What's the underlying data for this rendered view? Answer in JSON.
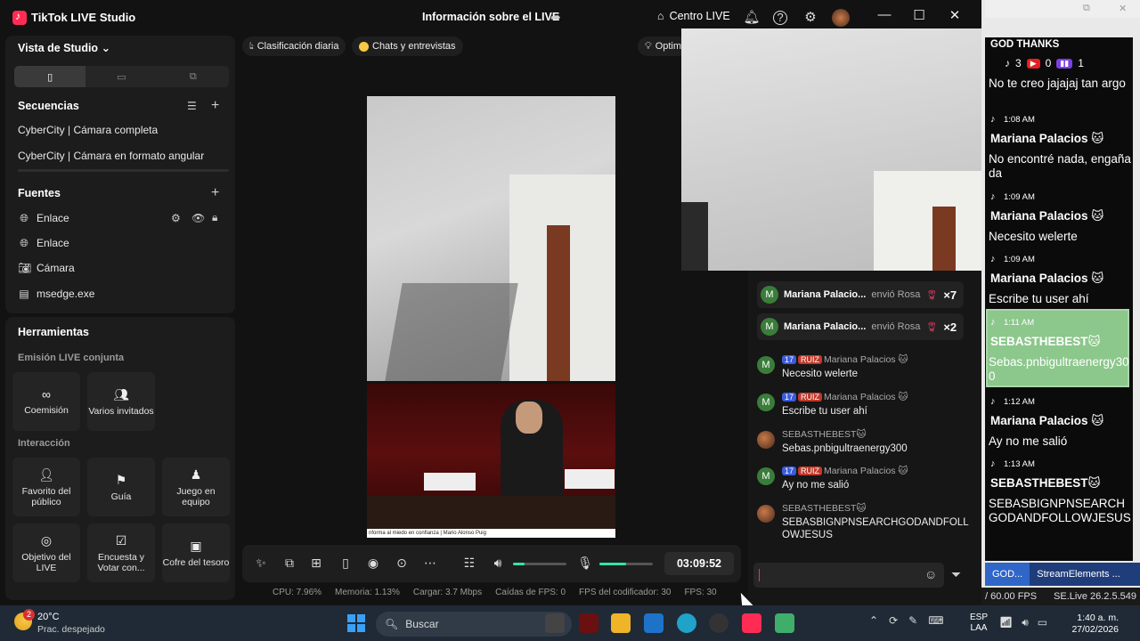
{
  "titlebar": {
    "app_name": "TikTok LIVE Studio",
    "center_title": "Información sobre el LIVE",
    "centro_live": "Centro LIVE"
  },
  "studio_panel": {
    "title": "Vista de Studio",
    "sequences_label": "Secuencias",
    "sequences": [
      "CyberCity | Cámara completa",
      "CyberCity | Cámara en formato angular"
    ],
    "sources_label": "Fuentes",
    "sources": [
      {
        "label": "Enlace",
        "icon": "globe-icon"
      },
      {
        "label": "Enlace",
        "icon": "globe-icon"
      },
      {
        "label": "Cámara",
        "icon": "camera-icon"
      },
      {
        "label": "msedge.exe",
        "icon": "window-icon"
      }
    ]
  },
  "tools_panel": {
    "title": "Herramientas",
    "section_joint": "Emisión LIVE conjunta",
    "coemision": "Coemisión",
    "varios_invitados": "Varios invitados",
    "section_interaction": "Interacción",
    "favorito": "Favorito del público",
    "guia": "Guía",
    "juego": "Juego en equipo",
    "objetivo": "Objetivo del LIVE",
    "encuesta": "Encuesta y Votar con...",
    "cofre": "Cofre del tesoro"
  },
  "chips": {
    "ranking": "Clasificación diaria",
    "chats": "Chats y entrevistas",
    "optim": "Optim"
  },
  "preview": {
    "caption": "nforma al miedo en confianza | Mario Alonso Puig"
  },
  "controls": {
    "timer": "03:09:52",
    "volume_level": 0.22,
    "mic_level": 0.5
  },
  "stats": {
    "cpu": "CPU: 7.96%",
    "memory": "Memoria: 1.13%",
    "upload": "Cargar: 3.7 Mbps",
    "fps_drops": "Caídas de FPS: 0",
    "encoder_fps": "FPS del codificador: 30",
    "fps": "FPS: 30"
  },
  "chat": {
    "gifts": [
      {
        "user": "Mariana Palacio...",
        "action": "envió Rosa",
        "count": "×7"
      },
      {
        "user": "Mariana Palacio...",
        "action": "envió Rosa",
        "count": "×2"
      }
    ],
    "messages": [
      {
        "level": "17",
        "fan": "RUIZ",
        "user": "Mariana Palacios 🐱",
        "text": "Necesito welerte",
        "avatar": "M"
      },
      {
        "level": "17",
        "fan": "RUIZ",
        "user": "Mariana Palacios 🐱",
        "text": "Escribe tu user ahí",
        "avatar": "M"
      },
      {
        "level": "",
        "fan": "",
        "user": "SEBASTHEBEST🐱",
        "text": "Sebas.pnbigultraenergy300",
        "avatar": ""
      },
      {
        "level": "17",
        "fan": "RUIZ",
        "user": "Mariana Palacios 🐱",
        "text": "Ay no me salió",
        "avatar": "M"
      },
      {
        "level": "",
        "fan": "",
        "user": "SEBASTHEBEST🐱",
        "text": "SEBASBIGNPNSEARCHGODANDFOLLOWJESUS",
        "avatar": ""
      }
    ]
  },
  "overlay": {
    "header": "GOD THANKS",
    "counts": {
      "tiktok": "3",
      "youtube": "0",
      "twitch": "1"
    },
    "first_text": "No te creo jajajaj tan argo",
    "entries": [
      {
        "time": "1:08 AM",
        "name": "Mariana Palacios 🐱",
        "text": "No encontré nada, engañada"
      },
      {
        "time": "1:09 AM",
        "name": "Mariana Palacios 🐱",
        "text": "Necesito welerte"
      },
      {
        "time": "1:09 AM",
        "name": "Mariana Palacios 🐱",
        "text": "Escribe tu user ahí"
      },
      {
        "time": "1:11 AM",
        "name": "SEBASTHEBEST🐱",
        "text": "Sebas.pnbigultraenergy300"
      },
      {
        "time": "1:12 AM",
        "name": "Mariana Palacios 🐱",
        "text": "Ay no me salió"
      },
      {
        "time": "1:13 AM",
        "name": "SEBASTHEBEST🐱",
        "text": "SEBASBIGNPNSEARCHGODANDFOLLOWJESUS"
      }
    ],
    "tabs": [
      "GOD...",
      "StreamElements ..."
    ],
    "fps": "/ 60.00 FPS",
    "version": "SE.Live 26.2.5.549"
  },
  "taskbar": {
    "weather_temp": "20°C",
    "weather_desc": "Prac. despejado",
    "weather_badge": "2",
    "search_placeholder": "Buscar",
    "lang_top": "ESP",
    "lang_bottom": "LAA",
    "time": "1:40 a. m.",
    "date": "27/02/2026"
  }
}
